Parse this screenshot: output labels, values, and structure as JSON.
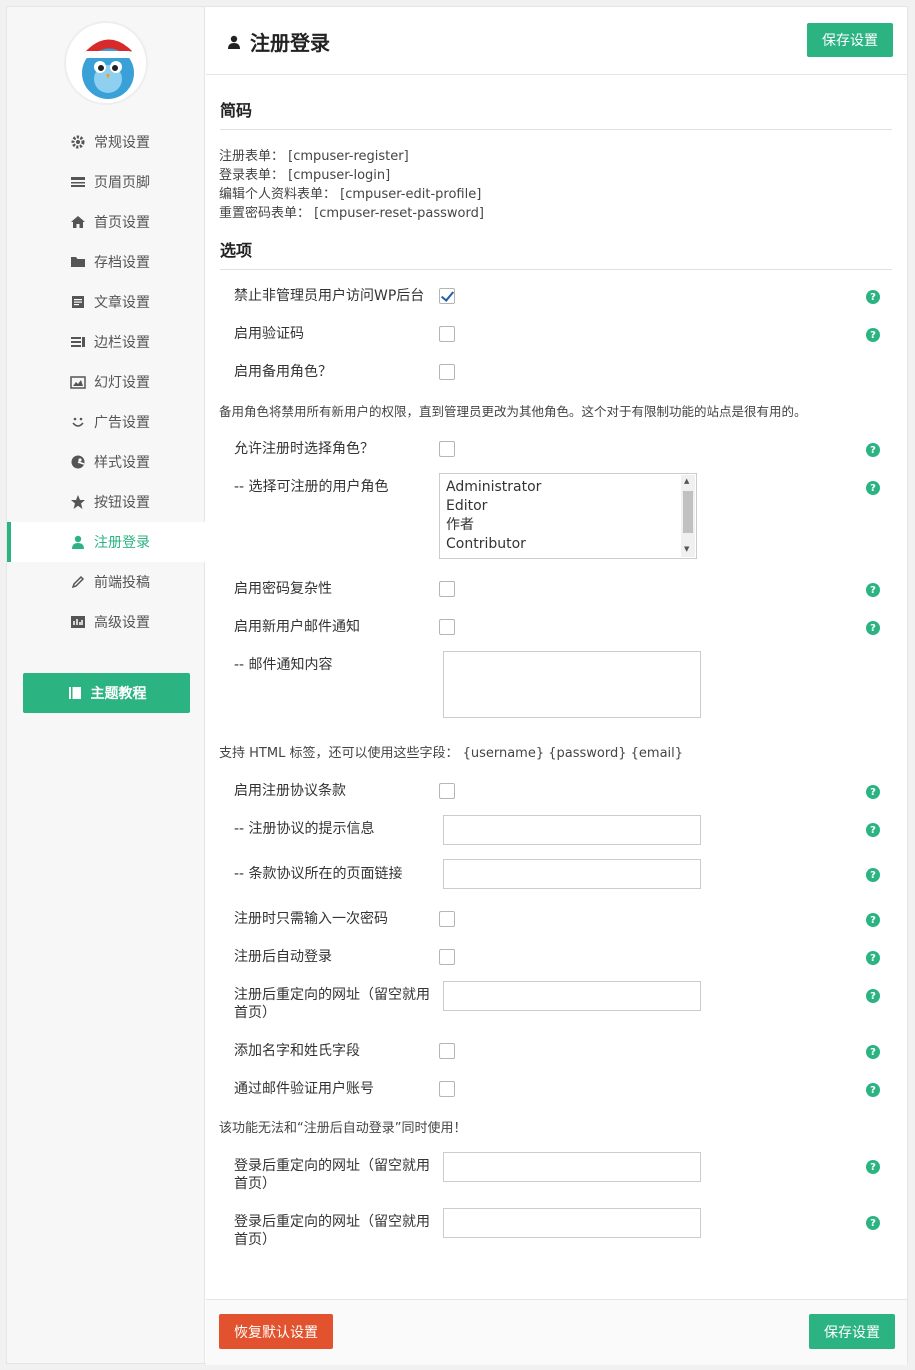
{
  "sidebar": {
    "items": [
      {
        "label": "常规设置",
        "icon": "gear-icon"
      },
      {
        "label": "页眉页脚",
        "icon": "header-footer-icon"
      },
      {
        "label": "首页设置",
        "icon": "home-icon"
      },
      {
        "label": "存档设置",
        "icon": "folder-icon"
      },
      {
        "label": "文章设置",
        "icon": "article-icon"
      },
      {
        "label": "边栏设置",
        "icon": "sidebar-icon"
      },
      {
        "label": "幻灯设置",
        "icon": "slides-icon"
      },
      {
        "label": "广告设置",
        "icon": "smile-icon"
      },
      {
        "label": "样式设置",
        "icon": "palette-icon"
      },
      {
        "label": "按钮设置",
        "icon": "star-icon"
      },
      {
        "label": "注册登录",
        "icon": "user-icon",
        "active": true
      },
      {
        "label": "前端投稿",
        "icon": "pencil-icon"
      },
      {
        "label": "高级设置",
        "icon": "advanced-icon"
      }
    ],
    "tutorial_button": "主题教程"
  },
  "header": {
    "title": "注册登录",
    "save_label": "保存设置"
  },
  "shortcodes": {
    "title": "简码",
    "lines": [
      "注册表单： [cmpuser-register]",
      "登录表单： [cmpuser-login]",
      "编辑个人资料表单： [cmpuser-edit-profile]",
      "重置密码表单： [cmpuser-reset-password]"
    ]
  },
  "options": {
    "title": "选项",
    "disable_admin": {
      "label": "禁止非管理员用户访问WP后台",
      "checked": true
    },
    "enable_captcha": {
      "label": "启用验证码",
      "checked": false
    },
    "enable_backup_role": {
      "label": "启用备用角色？",
      "checked": false
    },
    "backup_role_note": "备用角色将禁用所有新用户的权限，直到管理员更改为其他角色。这个对于有限制功能的站点是很有用的。",
    "allow_role_select": {
      "label": "允许注册时选择角色？",
      "checked": false
    },
    "selectable_roles": {
      "label": "-- 选择可注册的用户角色",
      "options": [
        "Administrator",
        "Editor",
        "作者",
        "Contributor"
      ]
    },
    "password_complexity": {
      "label": "启用密码复杂性",
      "checked": false
    },
    "new_user_email": {
      "label": "启用新用户邮件通知",
      "checked": false
    },
    "email_content": {
      "label": "-- 邮件通知内容",
      "value": ""
    },
    "html_note": "支持 HTML 标签，还可以使用这些字段： {username} {password} {email}",
    "enable_terms": {
      "label": "启用注册协议条款",
      "checked": false
    },
    "terms_hint": {
      "label": "-- 注册协议的提示信息",
      "value": ""
    },
    "terms_link": {
      "label": "-- 条款协议所在的页面链接",
      "value": ""
    },
    "single_password": {
      "label": "注册时只需输入一次密码",
      "checked": false
    },
    "auto_login": {
      "label": "注册后自动登录",
      "checked": false
    },
    "register_redirect": {
      "label": "注册后重定向的网址（留空就用首页）",
      "value": ""
    },
    "name_fields": {
      "label": "添加名字和姓氏字段",
      "checked": false
    },
    "email_verify": {
      "label": "通过邮件验证用户账号",
      "checked": false
    },
    "email_verify_note": "该功能无法和“注册后自动登录”同时使用！",
    "login_redirect_1": {
      "label": "登录后重定向的网址（留空就用首页）",
      "value": ""
    },
    "login_redirect_2": {
      "label": "登录后重定向的网址（留空就用首页）",
      "value": ""
    },
    "help_glyph": "?"
  },
  "footer": {
    "reset_label": "恢复默认设置",
    "save_label": "保存设置"
  },
  "colors": {
    "accent": "#2bb482",
    "danger": "#e2522e"
  }
}
